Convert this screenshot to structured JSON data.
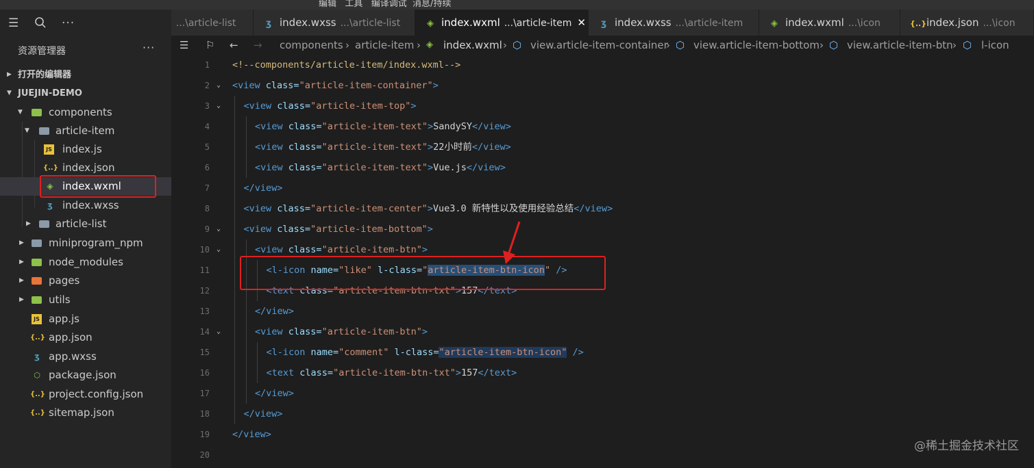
{
  "menubar": {
    "text": "编辑   工具   编译调试  消息/持续"
  },
  "colors": {
    "accent": "#007acc",
    "highlight": "#e02020",
    "js": "#e8c23a",
    "json": "#e8c23a",
    "wxml": "#8dc149",
    "wxss": "#519aba"
  },
  "tabs": [
    {
      "name": "",
      "path": "...\\article-list",
      "icon": "split-icon",
      "active": false
    },
    {
      "name": "index.wxss",
      "path": "...\\article-list",
      "icon": "css-file-icon",
      "active": false
    },
    {
      "name": "index.wxml",
      "path": "...\\article-item",
      "icon": "wxml-file-icon",
      "active": true,
      "close": "✕"
    },
    {
      "name": "index.wxss",
      "path": "...\\article-item",
      "icon": "css-file-icon",
      "active": false
    },
    {
      "name": "index.wxml",
      "path": "...\\icon",
      "icon": "wxml-file-icon",
      "active": false
    },
    {
      "name": "index.json",
      "path": "...\\icon",
      "icon": "json-file-icon",
      "active": false
    }
  ],
  "sidebar": {
    "title": "资源管理器",
    "more": "···",
    "rows": [
      {
        "label": "打开的编辑器",
        "section": true
      },
      {
        "label": "JUEJIN-DEMO",
        "section": true
      },
      {
        "label": "components",
        "type": "folder"
      },
      {
        "label": "article-item",
        "type": "folder"
      },
      {
        "label": "index.js",
        "type": "js"
      },
      {
        "label": "index.json",
        "type": "json"
      },
      {
        "label": "index.wxml",
        "type": "wxml",
        "selected": true
      },
      {
        "label": "index.wxss",
        "type": "wxss"
      },
      {
        "label": "article-list",
        "type": "folder"
      },
      {
        "label": "miniprogram_npm",
        "type": "folder"
      },
      {
        "label": "node_modules",
        "type": "folder"
      },
      {
        "label": "pages",
        "type": "folder"
      },
      {
        "label": "utils",
        "type": "folder"
      },
      {
        "label": "app.js",
        "type": "js"
      },
      {
        "label": "app.json",
        "type": "json"
      },
      {
        "label": "app.wxss",
        "type": "wxss"
      },
      {
        "label": "package.json",
        "type": "node"
      },
      {
        "label": "project.config.json",
        "type": "json"
      },
      {
        "label": "sitemap.json",
        "type": "json"
      }
    ]
  },
  "breadcrumb": {
    "items": [
      "components",
      "article-item",
      "index.wxml",
      "view.article-item-container",
      "view.article-item-bottom",
      "view.article-item-btn",
      "l-icon"
    ],
    "sep": "›"
  },
  "editor": {
    "lines": [
      {
        "n": "1",
        "parts": [
          [
            "c",
            "<!--components/article-item/index.wxml-->"
          ]
        ]
      },
      {
        "n": "2",
        "parts": [
          [
            "t",
            "<view "
          ],
          [
            "a",
            "class="
          ],
          [
            "s",
            "\"article-item-container\""
          ],
          [
            "t",
            ">"
          ]
        ]
      },
      {
        "n": "3",
        "parts": [
          [
            "t",
            "<view "
          ],
          [
            "a",
            "class="
          ],
          [
            "s",
            "\"article-item-top\""
          ],
          [
            "t",
            ">"
          ]
        ]
      },
      {
        "n": "4",
        "parts": [
          [
            "t",
            "<view "
          ],
          [
            "a",
            "class="
          ],
          [
            "s",
            "\"article-item-text\""
          ],
          [
            "t",
            ">"
          ],
          [
            "x",
            "SandySY"
          ],
          [
            "t",
            "</view>"
          ]
        ]
      },
      {
        "n": "5",
        "parts": [
          [
            "t",
            "<view "
          ],
          [
            "a",
            "class="
          ],
          [
            "s",
            "\"article-item-text\""
          ],
          [
            "t",
            ">"
          ],
          [
            "x",
            "22小时前"
          ],
          [
            "t",
            "</view>"
          ]
        ]
      },
      {
        "n": "6",
        "parts": [
          [
            "t",
            "<view "
          ],
          [
            "a",
            "class="
          ],
          [
            "s",
            "\"article-item-text\""
          ],
          [
            "t",
            ">"
          ],
          [
            "x",
            "Vue.js"
          ],
          [
            "t",
            "</view>"
          ]
        ]
      },
      {
        "n": "7",
        "parts": [
          [
            "t",
            "</view>"
          ]
        ]
      },
      {
        "n": "8",
        "parts": [
          [
            "t",
            "<view "
          ],
          [
            "a",
            "class="
          ],
          [
            "s",
            "\"article-item-center\""
          ],
          [
            "t",
            ">"
          ],
          [
            "x",
            "Vue3.0 新特性以及使用经验总结"
          ],
          [
            "t",
            "</view>"
          ]
        ]
      },
      {
        "n": "9",
        "parts": [
          [
            "t",
            "<view "
          ],
          [
            "a",
            "class="
          ],
          [
            "s",
            "\"article-item-bottom\""
          ],
          [
            "t",
            ">"
          ]
        ]
      },
      {
        "n": "10",
        "parts": [
          [
            "t",
            "<view "
          ],
          [
            "a",
            "class="
          ],
          [
            "s",
            "\"article-item-btn\""
          ],
          [
            "t",
            ">"
          ]
        ]
      },
      {
        "n": "11",
        "parts": [
          [
            "t",
            "<l-icon "
          ],
          [
            "a",
            "name="
          ],
          [
            "s",
            "\"like\""
          ],
          [
            "a",
            " l-class="
          ],
          [
            "s",
            "\""
          ],
          [
            "S",
            "article-item-btn-icon"
          ],
          [
            "s",
            "\""
          ],
          [
            "t",
            " />"
          ]
        ]
      },
      {
        "n": "12",
        "parts": [
          [
            "t",
            "<text "
          ],
          [
            "a",
            "class="
          ],
          [
            "s",
            "\"article-item-btn-txt\""
          ],
          [
            "t",
            ">"
          ],
          [
            "x",
            "157"
          ],
          [
            "t",
            "</text>"
          ]
        ]
      },
      {
        "n": "13",
        "parts": [
          [
            "t",
            "</view>"
          ]
        ]
      },
      {
        "n": "14",
        "parts": [
          [
            "t",
            "<view "
          ],
          [
            "a",
            "class="
          ],
          [
            "s",
            "\"article-item-btn\""
          ],
          [
            "t",
            ">"
          ]
        ]
      },
      {
        "n": "15",
        "parts": [
          [
            "t",
            "<l-icon "
          ],
          [
            "a",
            "name="
          ],
          [
            "s",
            "\"comment\""
          ],
          [
            "a",
            " l-class="
          ],
          [
            "H",
            "\"article-item-btn-icon\""
          ],
          [
            "t",
            " />"
          ]
        ]
      },
      {
        "n": "16",
        "parts": [
          [
            "t",
            "<text "
          ],
          [
            "a",
            "class="
          ],
          [
            "s",
            "\"article-item-btn-txt\""
          ],
          [
            "t",
            ">"
          ],
          [
            "x",
            "157"
          ],
          [
            "t",
            "</text>"
          ]
        ]
      },
      {
        "n": "17",
        "parts": [
          [
            "t",
            "</view>"
          ]
        ]
      },
      {
        "n": "18",
        "parts": [
          [
            "t",
            "</view>"
          ]
        ]
      },
      {
        "n": "19",
        "parts": [
          [
            "t",
            "</view>"
          ]
        ]
      },
      {
        "n": "20",
        "parts": []
      }
    ]
  },
  "watermark": "@稀土掘金技术社区"
}
